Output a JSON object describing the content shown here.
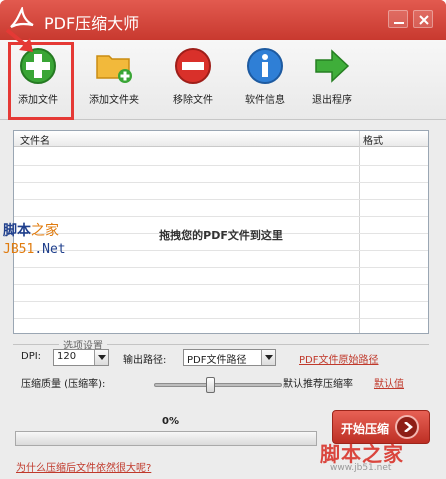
{
  "window": {
    "title": "PDF压缩大师",
    "icons": {
      "logo": "pdf-acrobat-icon",
      "minimize": "minimize-icon",
      "close": "close-icon"
    },
    "colors": {
      "titlebar": "#d8483e",
      "link": "#c0392b",
      "accent_green": "#3b9c3b"
    }
  },
  "toolbar": {
    "add_file": "添加文件",
    "add_folder": "添加文件夹",
    "remove_file": "移除文件",
    "software_info": "软件信息",
    "exit": "退出程序"
  },
  "file_list": {
    "col_name": "文件名",
    "col_format": "格式",
    "drop_hint": "拖拽您的PDF文件到这里",
    "rows": []
  },
  "watermark_left": {
    "line1_a": "脚本",
    "line1_b": "之家",
    "line2_a": "JB51",
    "line2_b": ".Net"
  },
  "options": {
    "legend": "选项设置",
    "dpi_label": "DPI:",
    "dpi_value": "120",
    "output_label": "输出路径:",
    "output_value": "PDF文件路径",
    "original_path_link": "PDF文件原始路径",
    "quality_label": "压缩质量 (压缩率):",
    "quality_desc": "默认推荐压缩率",
    "default_link": "默认值",
    "quality_level": 0.44
  },
  "progress": {
    "percent_text": "0%",
    "value": 0
  },
  "start_button": "开始压缩",
  "help_link": "为什么压缩后文件依然很大呢?",
  "watermark_right": {
    "line1": "脚本之家",
    "line2": "www.jb51.net"
  }
}
